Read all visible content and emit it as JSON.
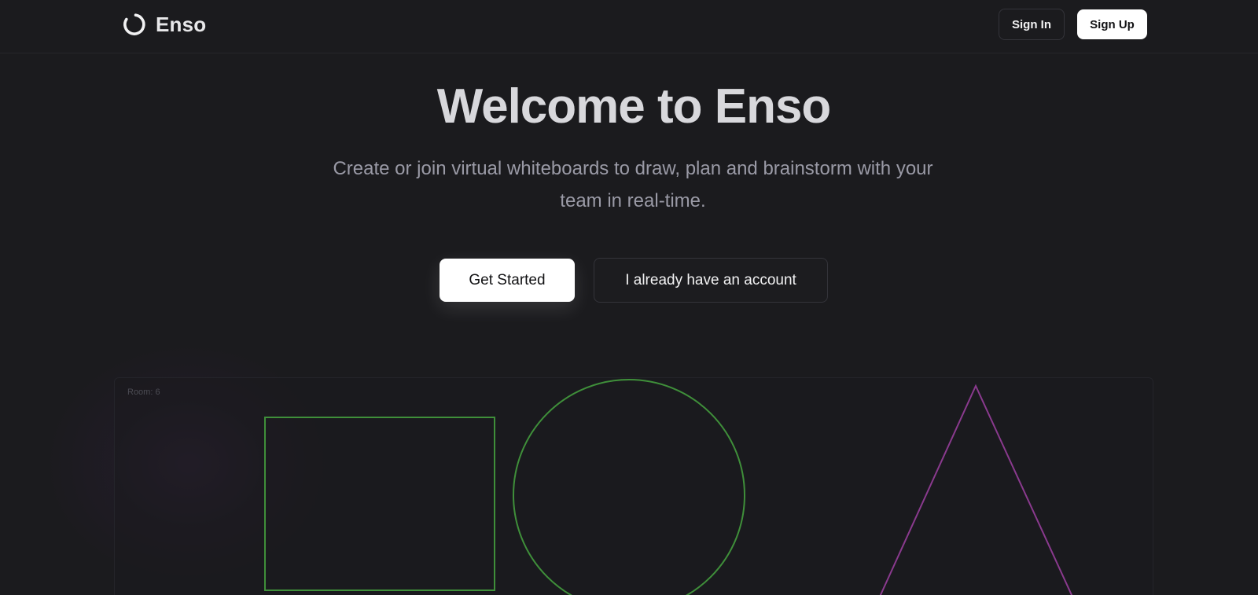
{
  "header": {
    "logo_text": "Enso",
    "logo_icon": "enso-circle-icon",
    "signin_label": "Sign In",
    "signup_label": "Sign Up"
  },
  "hero": {
    "title": "Welcome to Enso",
    "subtitle": "Create or join virtual whiteboards to draw, plan and brainstorm with your team in real-time.",
    "primary_cta": "Get Started",
    "secondary_cta": "I already have an account"
  },
  "board": {
    "room_label": "Room: 6",
    "shapes": [
      {
        "kind": "rectangle",
        "color": "#3f8f3a"
      },
      {
        "kind": "circle",
        "color": "#3f8f3a"
      },
      {
        "kind": "triangle",
        "color": "#8a3a8e"
      }
    ]
  },
  "colors": {
    "background": "#1b1b1e",
    "primary_button": "#ffffff",
    "green_stroke": "#3f8f3a",
    "purple_stroke": "#8a3a8e"
  }
}
